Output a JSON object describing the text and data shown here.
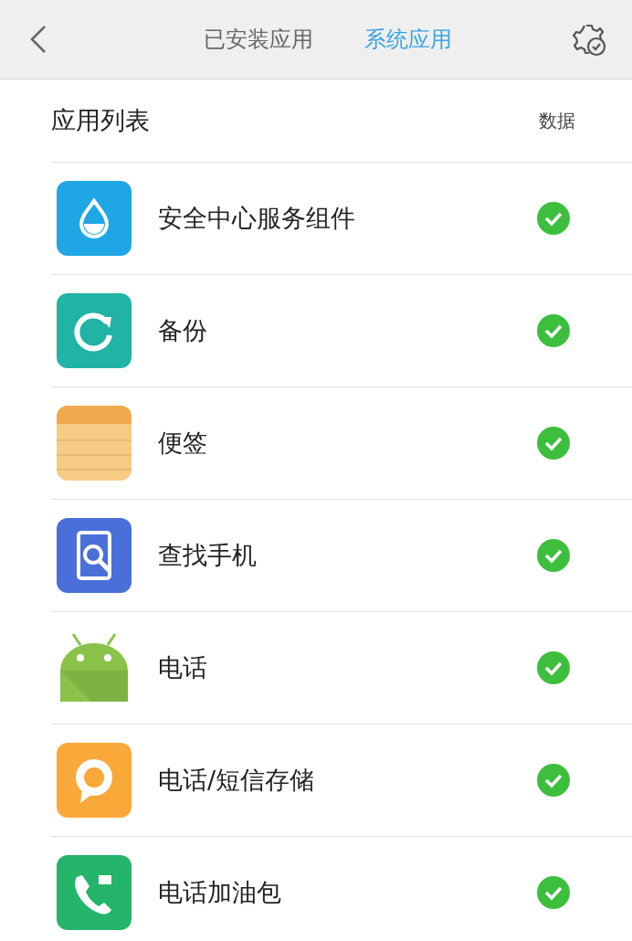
{
  "header": {
    "tabs": [
      {
        "label": "已安装应用",
        "selected": false
      },
      {
        "label": "系统应用",
        "selected": true
      }
    ]
  },
  "list_header": {
    "title": "应用列表",
    "column": "数据"
  },
  "apps": [
    {
      "kind": "drop",
      "name": "安全中心服务组件",
      "checked": true
    },
    {
      "kind": "backup",
      "name": "备份",
      "checked": true
    },
    {
      "kind": "notes",
      "name": "便签",
      "checked": true
    },
    {
      "kind": "find",
      "name": "查找手机",
      "checked": true
    },
    {
      "kind": "android",
      "name": "电话",
      "checked": true
    },
    {
      "kind": "chat",
      "name": "电话/短信存储",
      "checked": true
    },
    {
      "kind": "phone",
      "name": "电话加油包",
      "checked": true
    }
  ]
}
